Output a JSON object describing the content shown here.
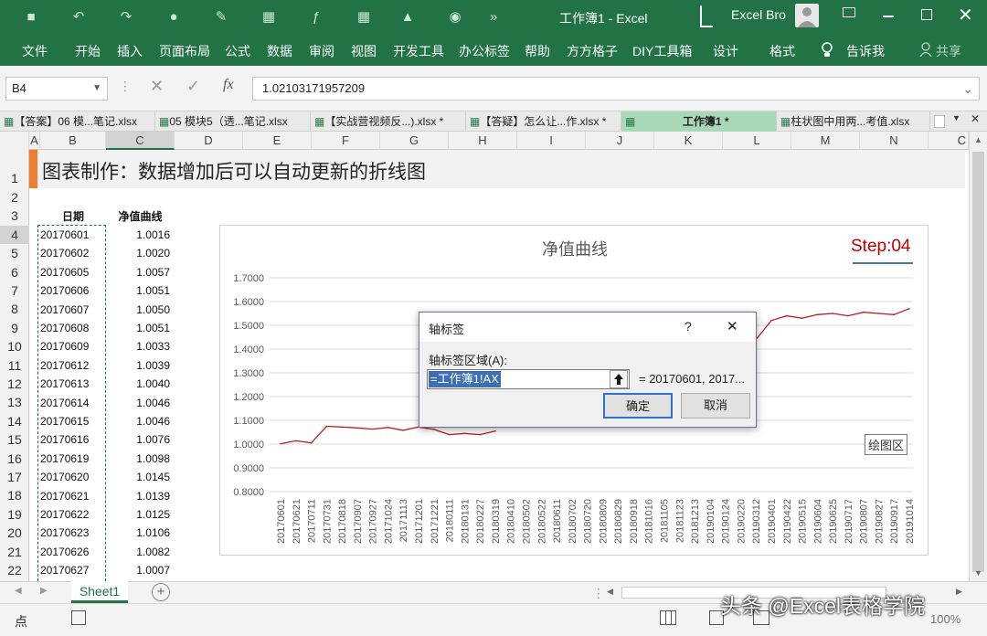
{
  "window": {
    "title": "工作簿1 - Excel",
    "user": "Excel Bro",
    "controls": [
      "restore-ribbon",
      "minimize",
      "maximize",
      "close"
    ]
  },
  "ribbon_tabs": [
    "文件",
    "开始",
    "插入",
    "页面布局",
    "公式",
    "数据",
    "审阅",
    "视图",
    "开发工具",
    "办公标签",
    "帮助",
    "方方格子",
    "DIY工具箱",
    "设计",
    "格式"
  ],
  "tell_me": "告诉我",
  "share": "共享",
  "formula_bar": {
    "name_box": "B4",
    "fx_label": "fx",
    "formula": "1.02103171957209"
  },
  "file_tabs": [
    {
      "label": "【答案】06 模...笔记.xlsx",
      "active": false
    },
    {
      "label": "05 模块5（透...笔记.xlsx",
      "active": false
    },
    {
      "label": "【实战营视频反...).xlsx *",
      "active": false
    },
    {
      "label": "【答疑】怎么让...作.xlsx *",
      "active": false
    },
    {
      "label": "工作簿1 *",
      "active": true
    },
    {
      "label": "柱状图中用两...考值.xlsx",
      "active": false
    }
  ],
  "columns": [
    "A",
    "B",
    "C",
    "D",
    "E",
    "F",
    "G",
    "H",
    "I",
    "J",
    "K",
    "L",
    "M",
    "N",
    "C"
  ],
  "rows": [
    "1",
    "2",
    "3",
    "4",
    "5",
    "6",
    "7",
    "8",
    "9",
    "10",
    "11",
    "12",
    "13",
    "14",
    "15",
    "16",
    "17",
    "18",
    "19",
    "20",
    "21",
    "22"
  ],
  "sheet": {
    "title": "图表制作：数据增加后可以自动更新的折线图",
    "header_date": "日期",
    "header_nav": "净值曲线",
    "data": [
      [
        "20170601",
        "1.0016"
      ],
      [
        "20170602",
        "1.0020"
      ],
      [
        "20170605",
        "1.0057"
      ],
      [
        "20170606",
        "1.0051"
      ],
      [
        "20170607",
        "1.0050"
      ],
      [
        "20170608",
        "1.0051"
      ],
      [
        "20170609",
        "1.0033"
      ],
      [
        "20170612",
        "1.0039"
      ],
      [
        "20170613",
        "1.0040"
      ],
      [
        "20170614",
        "1.0046"
      ],
      [
        "20170615",
        "1.0046"
      ],
      [
        "20170616",
        "1.0076"
      ],
      [
        "20170619",
        "1.0098"
      ],
      [
        "20170620",
        "1.0145"
      ],
      [
        "20170621",
        "1.0139"
      ],
      [
        "20170622",
        "1.0125"
      ],
      [
        "20170623",
        "1.0106"
      ],
      [
        "20170626",
        "1.0082"
      ],
      [
        "20170627",
        "1.0007"
      ]
    ]
  },
  "chart_data": {
    "type": "line",
    "title": "净值曲线",
    "step_label": "Step:04",
    "plot_area_tooltip": "绘图区",
    "ylim": [
      0.8,
      1.7
    ],
    "yticks": [
      "1.7000",
      "1.6000",
      "1.5000",
      "1.4000",
      "1.3000",
      "1.2000",
      "1.1000",
      "1.0000",
      "0.9000",
      "0.8000"
    ],
    "x": [
      "20170601",
      "20170621",
      "20170711",
      "20170731",
      "20170818",
      "20170907",
      "20170927",
      "20171024",
      "20171113",
      "20171201",
      "20171221",
      "20180111",
      "20180131",
      "20180227",
      "20180319",
      "20180410",
      "20180502",
      "20180522",
      "20180611",
      "20180702",
      "20180720",
      "20180809",
      "20180829",
      "20180918",
      "20181016",
      "20181105",
      "20181123",
      "20181213",
      "20190104",
      "20190124",
      "20190220",
      "20190312",
      "20190401",
      "20190422",
      "20190515",
      "20190604",
      "20190625",
      "20190717",
      "20190807",
      "20190827",
      "20190917",
      "20191014"
    ],
    "series": [
      {
        "values": [
          1.0016,
          1.0139,
          1.005,
          1.075,
          1.072,
          1.068,
          1.063,
          1.07,
          1.058,
          1.072,
          1.062,
          1.04,
          1.045,
          1.04,
          1.055,
          null,
          null,
          null,
          null,
          null,
          null,
          null,
          null,
          null,
          null,
          null,
          null,
          null,
          null,
          null,
          1.42,
          1.44,
          1.52,
          1.54,
          1.53,
          1.545,
          1.55,
          1.54,
          1.555,
          1.55,
          1.545,
          1.57
        ]
      }
    ],
    "line_color": "#b22222"
  },
  "dialog": {
    "title": "轴标签",
    "help": "?",
    "close": "✕",
    "field_label": "轴标签区域(A):",
    "field_value": "=工作簿1!AX",
    "preview": "= 20170601, 2017...",
    "ok": "确定",
    "cancel": "取消"
  },
  "sheet_tabs": [
    "Sheet1"
  ],
  "status": {
    "mode": "点",
    "zoom": "100%"
  },
  "watermark": "头条 @Excel表格学院"
}
